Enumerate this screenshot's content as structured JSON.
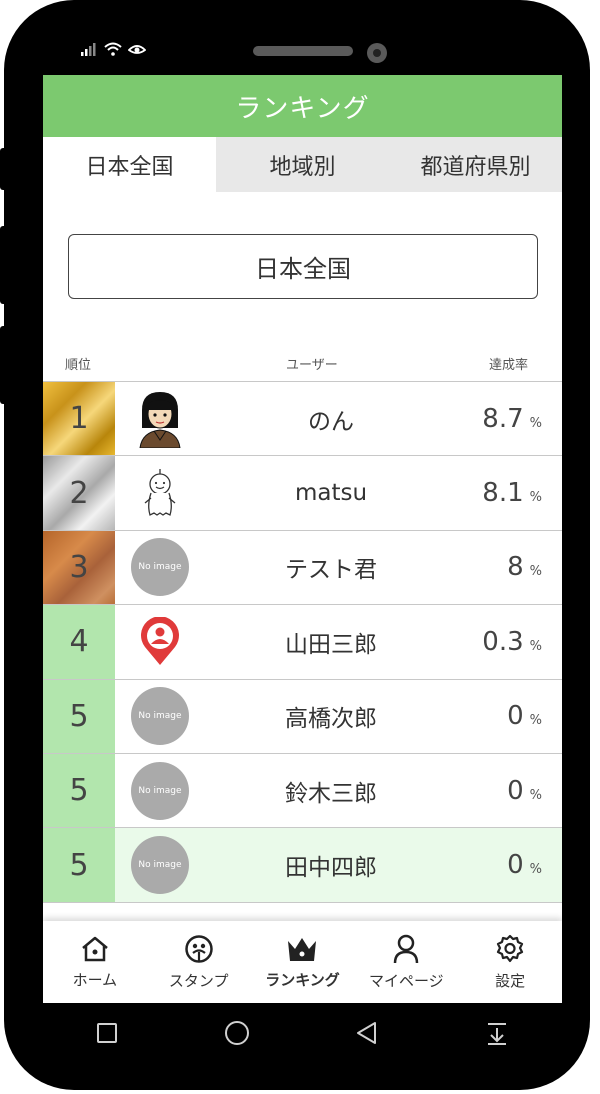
{
  "header": {
    "title": "ランキング"
  },
  "tabs": [
    {
      "label": "日本全国",
      "active": true
    },
    {
      "label": "地域別",
      "active": false
    },
    {
      "label": "都道府県別",
      "active": false
    }
  ],
  "region_select": {
    "value": "日本全国"
  },
  "columns": {
    "rank": "順位",
    "user": "ユーザー",
    "rate": "達成率"
  },
  "rows": [
    {
      "rank": "1",
      "name": "のん",
      "rate": "8.7",
      "unit": "%",
      "avatar": "girl-avatar"
    },
    {
      "rank": "2",
      "name": "matsu",
      "rate": "8.1",
      "unit": "%",
      "avatar": "stick-figure-avatar"
    },
    {
      "rank": "3",
      "name": "テスト君",
      "rate": "8",
      "unit": "%",
      "avatar": "No image"
    },
    {
      "rank": "4",
      "name": "山田三郎",
      "rate": "0.3",
      "unit": "%",
      "avatar": "location-pin-avatar"
    },
    {
      "rank": "5",
      "name": "高橋次郎",
      "rate": "0",
      "unit": "%",
      "avatar": "No image"
    },
    {
      "rank": "5",
      "name": "鈴木三郎",
      "rate": "0",
      "unit": "%",
      "avatar": "No image"
    },
    {
      "rank": "5",
      "name": "田中四郎",
      "rate": "0",
      "unit": "%",
      "avatar": "No image"
    }
  ],
  "bottom_nav": [
    {
      "label": "ホーム",
      "icon": "home-icon"
    },
    {
      "label": "スタンプ",
      "icon": "stamp-icon"
    },
    {
      "label": "ランキング",
      "icon": "crown-icon",
      "active": true
    },
    {
      "label": "マイページ",
      "icon": "person-icon"
    },
    {
      "label": "設定",
      "icon": "gear-icon"
    }
  ],
  "colors": {
    "accent": "#7cc96f",
    "gold": "#d9a520",
    "silver": "#c0c0c0",
    "bronze": "#c0773a",
    "rank_green": "#b2e6ad",
    "highlight_row": "#eafaea",
    "no_image": "#aaaaaa"
  }
}
